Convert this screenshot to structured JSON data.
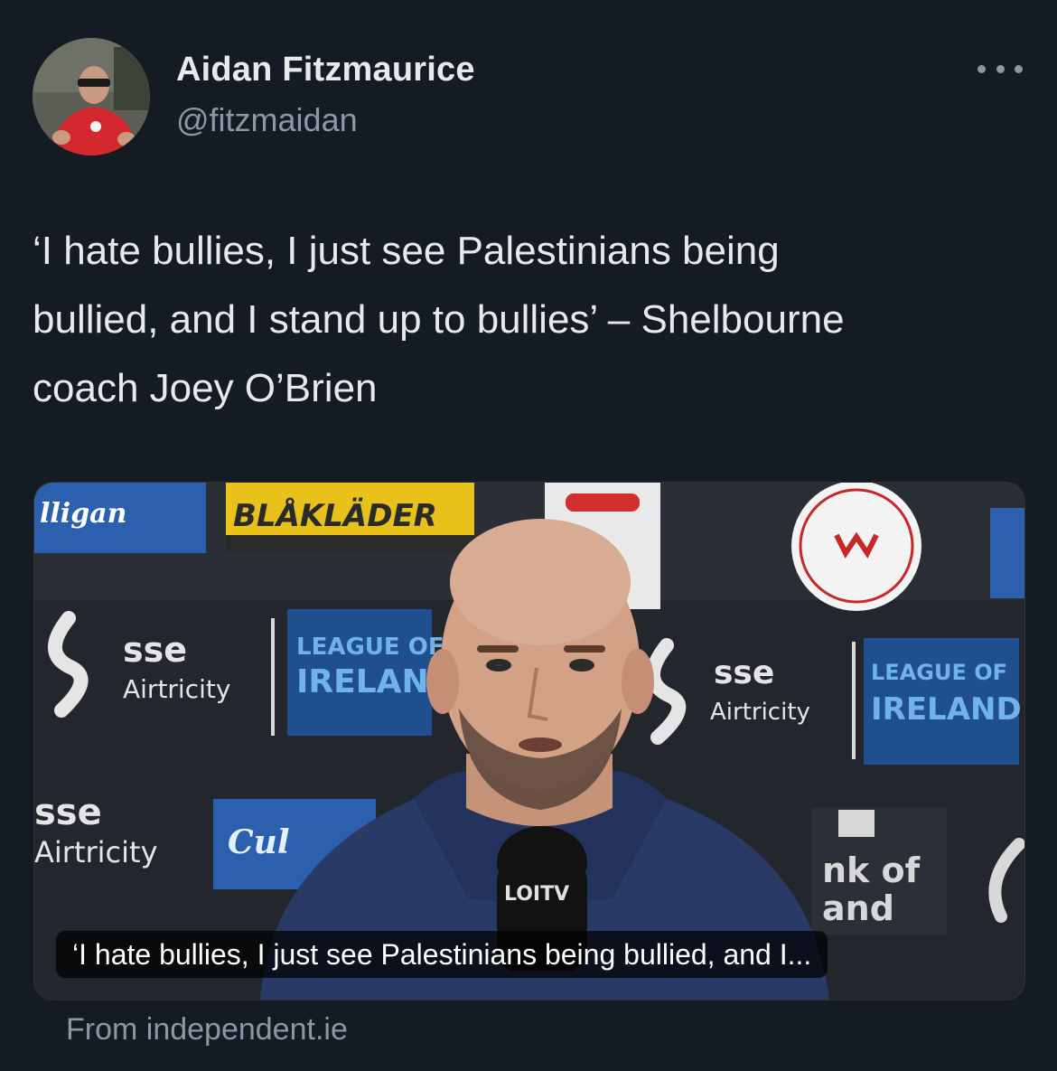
{
  "author": {
    "name": "Aidan Fitzmaurice",
    "handle": "@fitzmaidan",
    "avatar_icon": "avatar-photo"
  },
  "menu": {
    "icon": "more-horizontal-icon"
  },
  "tweet": {
    "text_line1": "‘I hate bullies, I just see Palestinians being",
    "text_line2": "bullied, and I stand up to bullies’ – Shelbourne",
    "text_line3": "coach Joey O’Brien"
  },
  "link_card": {
    "caption": "‘I hate bullies, I just see Palestinians being bullied, and I...",
    "source": "From independent.ie",
    "background_text": {
      "left_logo": "lligan",
      "top_brand": "BLÅKLÄDER",
      "sse": "sse",
      "airtricity": "Airtricity",
      "league_line1": "LEAGUE OF",
      "league_line2": "IRELAND",
      "mic_label": "LOITV",
      "bank_line1": "nk of",
      "bank_line2": "and",
      "cul": "Cul"
    }
  },
  "colors": {
    "background": "#141b22",
    "primary_text": "#e7e9ea",
    "secondary_text": "#8b98a5"
  }
}
